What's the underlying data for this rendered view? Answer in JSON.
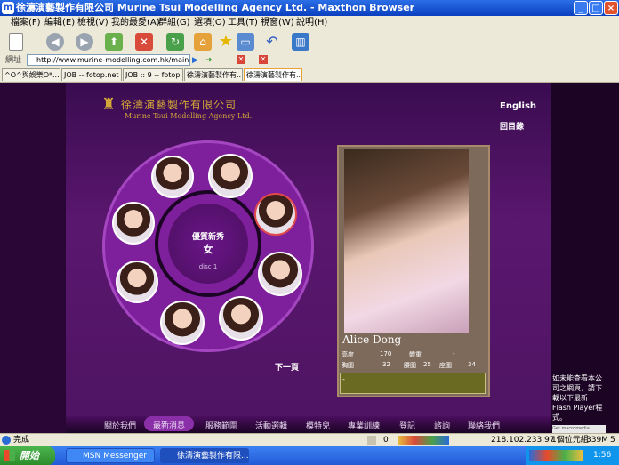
{
  "window": {
    "title": "徐濤演藝製作有限公司 Murine Tsui Modelling Agency Ltd. - Maxthon Browser",
    "controls": [
      "_",
      "□",
      "×"
    ]
  },
  "menu": [
    "檔案(F)",
    "編輯(E)",
    "檢視(V)",
    "我的最愛(A)",
    "群組(G)",
    "選項(O)",
    "工具(T)",
    "視窗(W)",
    "說明(H)"
  ],
  "address": {
    "label": "網址",
    "url": "http://www.murine-modelling.com.hk/main_chinese.h"
  },
  "tabs": [
    {
      "label": "^O^與娛樂O*..."
    },
    {
      "label": "JOB -- fotop.net p..."
    },
    {
      "label": "JOB :: 9 -- fotop.ne..."
    },
    {
      "label": "徐濤演藝製作有..."
    },
    {
      "label": "徐濤演藝製作有..."
    }
  ],
  "site": {
    "logo_cn": "徐濤演藝製作有限公司",
    "logo_en": "Murine Tsui Modelling Agency Ltd.",
    "lang_link": "English",
    "back_link": "回目錄",
    "wheel_title": "優質新秀",
    "wheel_subtitle": "女",
    "wheel_disc": "disc 1",
    "next_link": "下一頁",
    "model_name": "Alice Dong",
    "stats": [
      {
        "label": "高度",
        "value": "170"
      },
      {
        "label": "體重",
        "value": "-"
      },
      {
        "label": "胸圍",
        "value": "32"
      },
      {
        "label": "腰圍",
        "value": "25"
      },
      {
        "label": "座圍",
        "value": "34"
      }
    ],
    "info_box": "-",
    "flash_notice": "如未能查看本公司之網頁，請下載以下最新 Flash Player程式。",
    "flash_badge": "Get macromedia",
    "nav": [
      "關於我們",
      "最新消息",
      "服務範圍",
      "活動選輯",
      "模特兒",
      "專業訓練",
      "登記",
      "諮詢",
      "聯絡我們"
    ]
  },
  "status": {
    "text": "完成",
    "count": "0",
    "ip": "218.102.233.97",
    "mode": "1個位元組",
    "mem": "339M",
    "num": "5"
  },
  "taskbar": {
    "start": "開始",
    "tasks": [
      {
        "label": "MSN Messenger"
      },
      {
        "label": "徐濤演藝製作有限..."
      }
    ],
    "clock": "1:56"
  },
  "colors": {
    "accent": "#8a2fa8",
    "panel": "#5a176e",
    "gold": "#d4a838"
  }
}
